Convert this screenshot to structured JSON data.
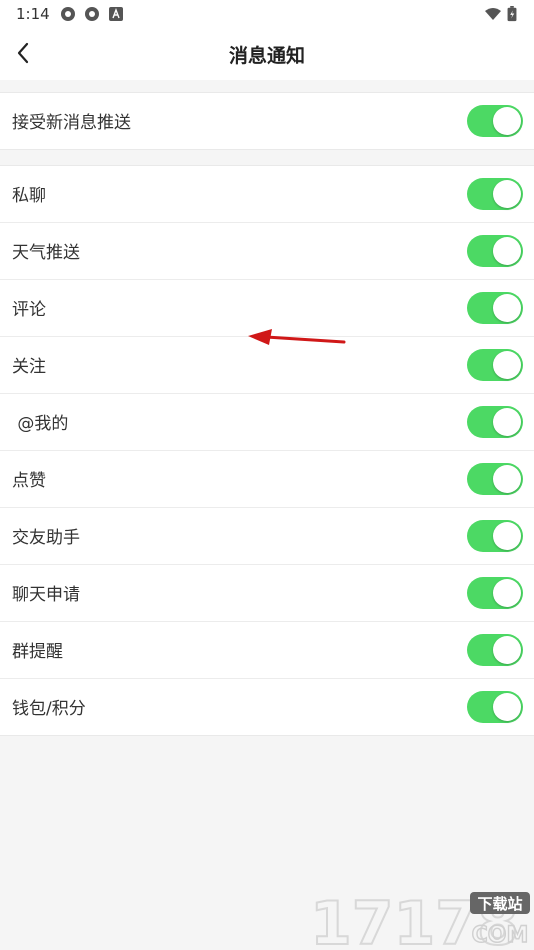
{
  "status_bar": {
    "time": "1:14",
    "left_icons": [
      "gear-icon",
      "gear-icon",
      "app-a-icon"
    ],
    "right_icons": [
      "wifi-icon",
      "battery-icon"
    ]
  },
  "header": {
    "title": "消息通知",
    "back_icon": "chevron-left-icon"
  },
  "colors": {
    "toggle_on": "#4cd964",
    "annotation_arrow": "#d01818"
  },
  "master": {
    "label": "接受新消息推送",
    "enabled": true
  },
  "settings": [
    {
      "label": "私聊",
      "enabled": true
    },
    {
      "label": "天气推送",
      "enabled": true
    },
    {
      "label": "评论",
      "enabled": true
    },
    {
      "label": "关注",
      "enabled": true
    },
    {
      "label": " @我的",
      "enabled": true
    },
    {
      "label": "点赞",
      "enabled": true
    },
    {
      "label": "交友助手",
      "enabled": true
    },
    {
      "label": "聊天申请",
      "enabled": true
    },
    {
      "label": "群提醒",
      "enabled": true
    },
    {
      "label": "钱包/积分",
      "enabled": true
    }
  ],
  "watermark": {
    "number": "17178",
    "tag": "下载站",
    "domain": "COM"
  }
}
